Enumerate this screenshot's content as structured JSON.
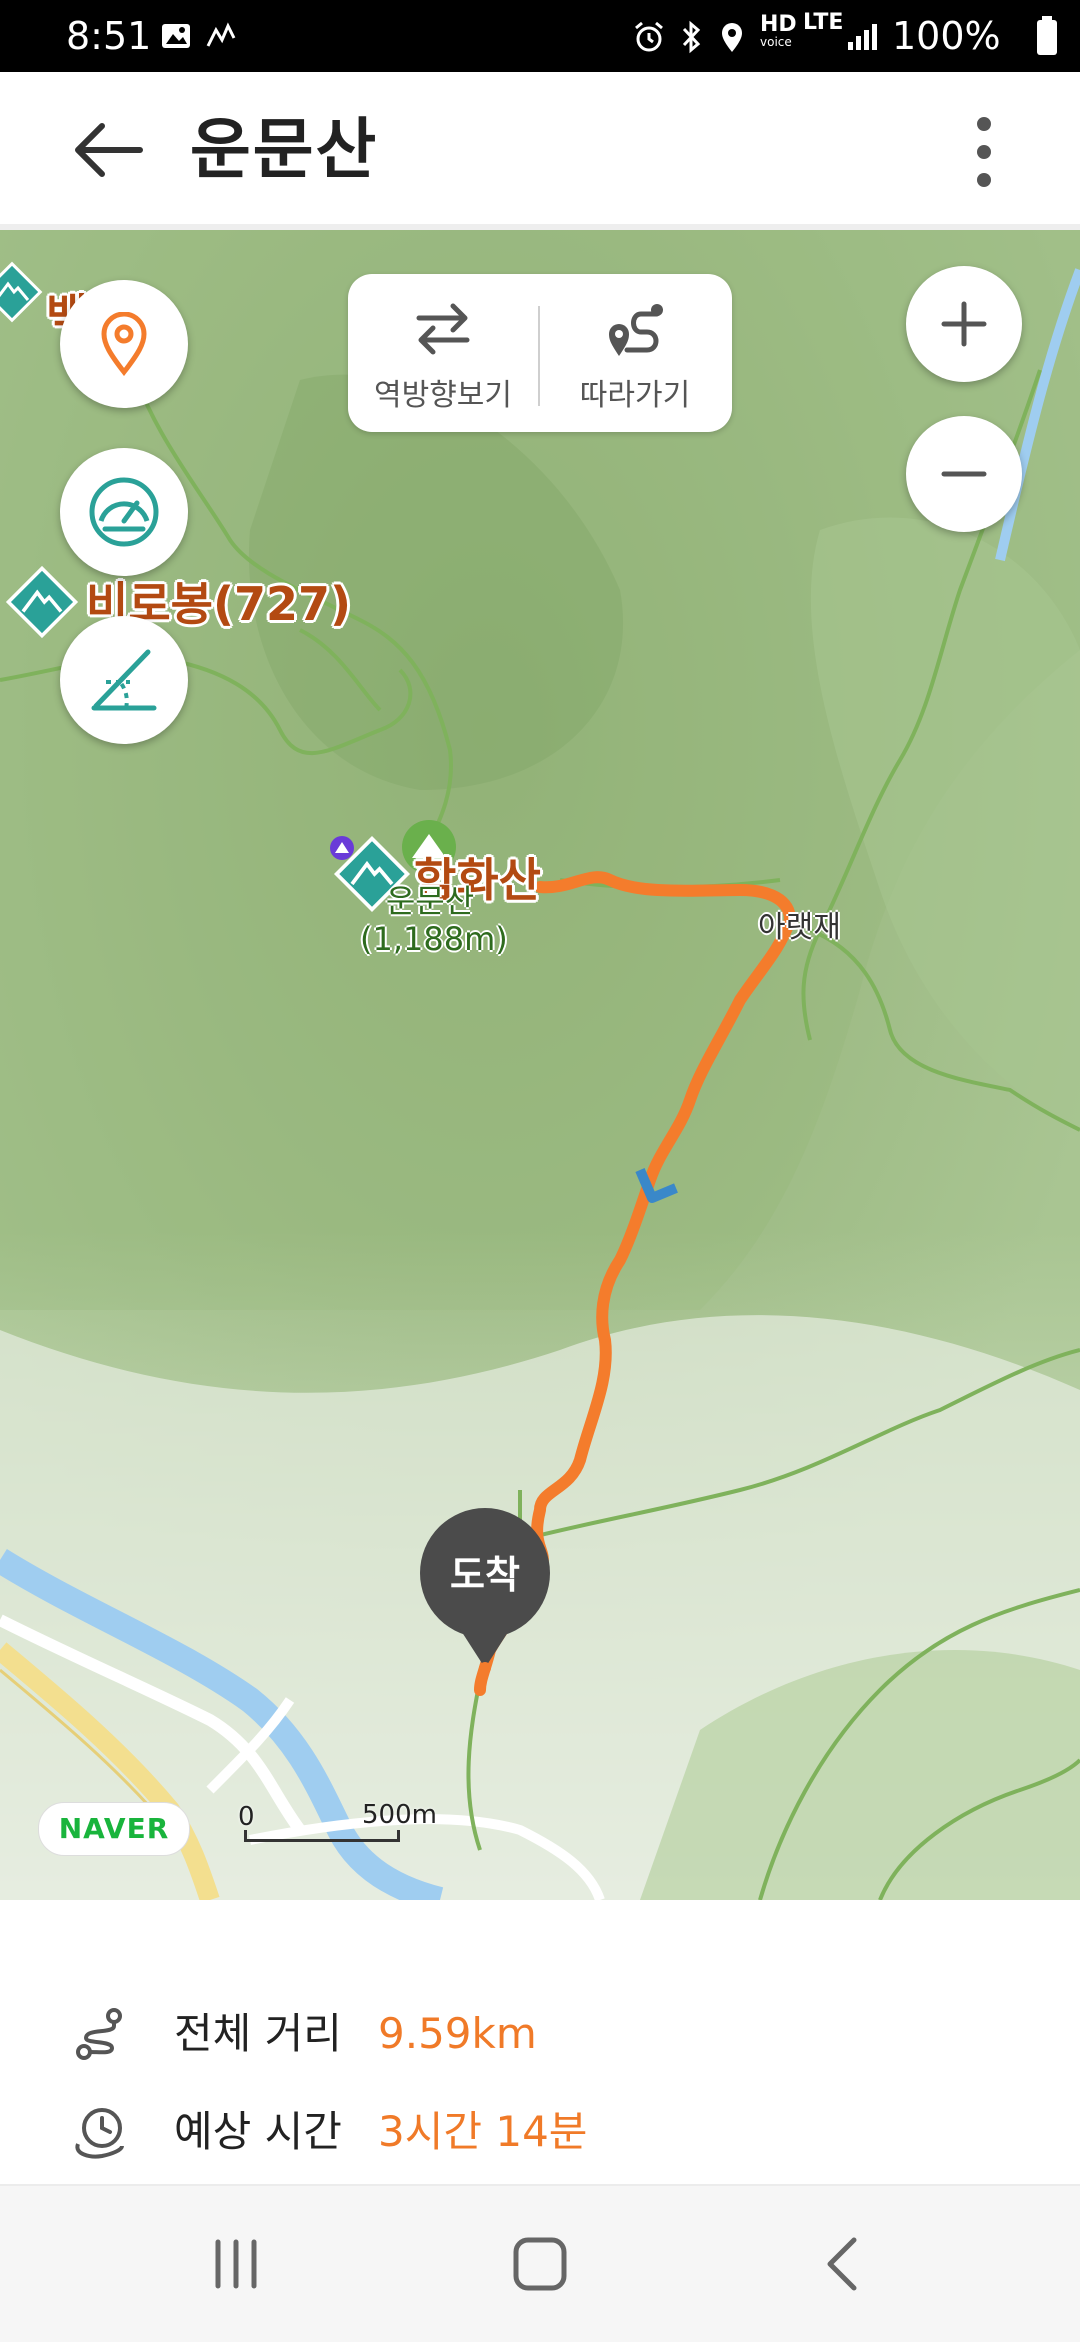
{
  "status_bar": {
    "time": "8:51",
    "network_hd": "HD",
    "network_hd_sub": "voice",
    "network_lte": "LTE",
    "battery": "100%",
    "icons": [
      "gallery-icon",
      "activity-icon",
      "alarm-icon",
      "bluetooth-icon",
      "location-icon",
      "signal-icon",
      "battery-icon"
    ]
  },
  "header": {
    "title": "운문산",
    "back_icon": "arrow-left-icon",
    "menu_icon": "more-vertical-icon"
  },
  "map": {
    "toggles": {
      "reverse_label": "역방향보기",
      "follow_label": "따라가기"
    },
    "side_buttons": [
      "location-pin-icon",
      "speedometer-icon",
      "slope-icon"
    ],
    "zoom": {
      "in": "+",
      "out": "−"
    },
    "labels": {
      "peak_top_partial": "백",
      "biro": "비로봉(727)",
      "hamhwa": "함화산",
      "unmun_name": "운문산",
      "unmun_height": "(1,188m)",
      "pass": "아랫재"
    },
    "arrival_label": "도착",
    "brand": "NAVER",
    "scale_zero": "0",
    "scale_distance": "500m",
    "colors": {
      "route": "#f47c2c",
      "label": "#b34a12",
      "accent": "#2aa198"
    }
  },
  "summary": {
    "distance_label": "전체 거리",
    "distance_value": "9.59km",
    "time_label": "예상 시간",
    "time_value": "3시간 14분"
  },
  "nav": {
    "recent_icon": "recent-apps-icon",
    "home_icon": "home-icon",
    "back_icon": "nav-back-icon"
  }
}
